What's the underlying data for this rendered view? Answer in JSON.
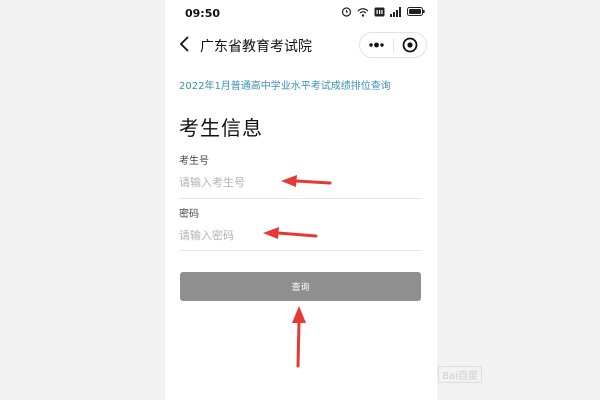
{
  "status_bar": {
    "time": "09:50"
  },
  "nav": {
    "title": "广东省教育考试院"
  },
  "page": {
    "subtitle": "2022年1月普通高中学业水平考试成绩排位查询",
    "heading": "考生信息"
  },
  "form": {
    "exam_number": {
      "label": "考生号",
      "placeholder": "请输入考生号",
      "value": ""
    },
    "password": {
      "label": "密码",
      "placeholder": "请输入密码",
      "value": ""
    },
    "submit_label": "查询"
  },
  "icons": {
    "back": "chevron-left-icon",
    "more": "more-dots-icon",
    "close": "target-close-icon",
    "alarm": "alarm-icon",
    "wifi": "wifi-icon",
    "signal": "signal-icon",
    "battery": "battery-icon"
  },
  "colors": {
    "subtitle": "#3b8fb8",
    "button_bg": "#8f8f8f",
    "arrow": "#e53935"
  }
}
